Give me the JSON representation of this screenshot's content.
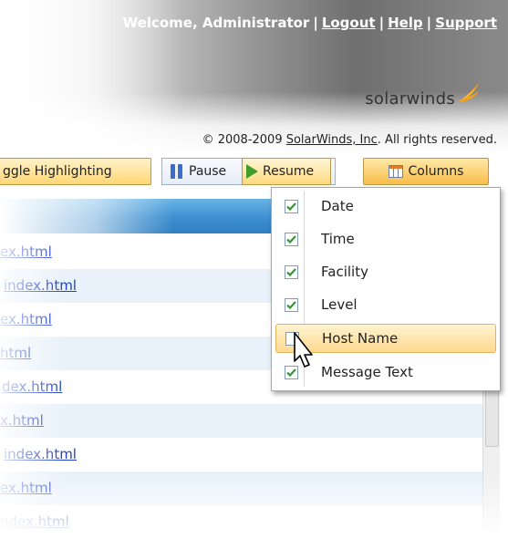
{
  "header": {
    "welcome_text": "Welcome, Administrator",
    "links": [
      "Logout",
      "Help",
      "Support"
    ],
    "brand": "solarwinds",
    "copyright_prefix": "© 2008-2009 ",
    "copyright_link": "SolarWinds, Inc",
    "copyright_suffix": ". All rights reserved."
  },
  "toolbar": {
    "toggle_label": "ggle Highlighting",
    "pause_label": "Pause",
    "resume_label": "Resume",
    "columns_label": "Columns"
  },
  "table": {
    "rows": [
      "ex.html",
      "index.html",
      "ex.html",
      "html",
      "dex.html",
      "x.html",
      "index.html",
      "ex.html",
      "ndex.html"
    ]
  },
  "columns_menu": {
    "items": [
      {
        "label": "Date",
        "checked": true
      },
      {
        "label": "Time",
        "checked": true
      },
      {
        "label": "Facility",
        "checked": true
      },
      {
        "label": "Level",
        "checked": true
      },
      {
        "label": "Host Name",
        "checked": false
      },
      {
        "label": "Message Text",
        "checked": true
      }
    ]
  },
  "colors": {
    "accent_orange": "#ffd774",
    "header_blue": "#3e8fd0",
    "link_blue": "#1f3fc9",
    "check_green": "#2e9a2e"
  }
}
